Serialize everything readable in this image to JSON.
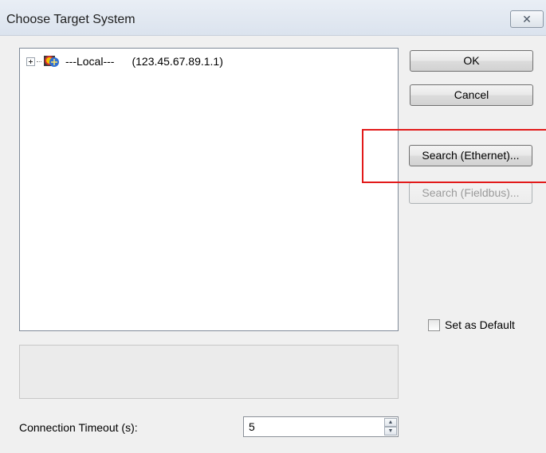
{
  "window": {
    "title": "Choose Target System",
    "close_glyph": "✕"
  },
  "tree": {
    "items": [
      {
        "name": "---Local---",
        "address": "(123.45.67.89.1.1)",
        "icon": "network-globe-icon"
      }
    ]
  },
  "buttons": {
    "ok": "OK",
    "cancel": "Cancel",
    "search_ethernet": "Search (Ethernet)...",
    "search_fieldbus": "Search (Fieldbus)..."
  },
  "set_default": {
    "label": "Set as Default",
    "checked": false
  },
  "timeout": {
    "label": "Connection Timeout (s):",
    "value": "5",
    "up_glyph": "▲",
    "down_glyph": "▼"
  },
  "colors": {
    "highlight": "#e21a1a",
    "accent": "#2a64b8"
  }
}
